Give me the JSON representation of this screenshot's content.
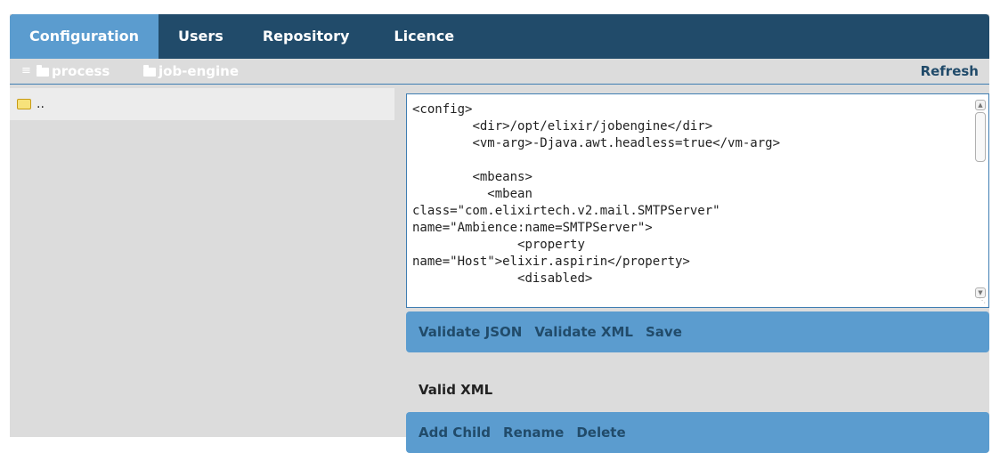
{
  "tabs": [
    "Configuration",
    "Users",
    "Repository",
    "Licence"
  ],
  "active_tab": "Configuration",
  "breadcrumb": {
    "menu_icon": "menu-icon",
    "items": [
      "process",
      "job-engine"
    ]
  },
  "refresh_label": "Refresh",
  "file_list": {
    "items": [
      ".."
    ]
  },
  "editor": {
    "content": "<config>\n        <dir>/opt/elixir/jobengine</dir>\n        <vm-arg>-Djava.awt.headless=true</vm-arg>\n\n        <mbeans>\n          <mbean\nclass=\"com.elixirtech.v2.mail.SMTPServer\"\nname=\"Ambience:name=SMTPServer\">\n              <property\nname=\"Host\">elixir.aspirin</property>\n              <disabled>"
  },
  "validate_bar": {
    "validate_json": "Validate JSON",
    "validate_xml": "Validate XML",
    "save": "Save"
  },
  "status": "Valid XML",
  "item_bar": {
    "add_child": "Add Child",
    "rename": "Rename",
    "delete": "Delete"
  },
  "colors": {
    "header": "#214b6a",
    "accent": "#5b9ccf",
    "panel_bg": "#dcdcdc"
  }
}
